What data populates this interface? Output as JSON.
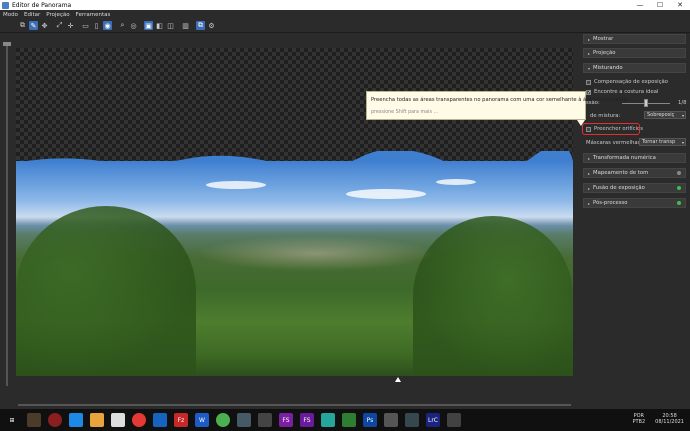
{
  "window": {
    "title": "Editor de Panorama",
    "minimize": "—",
    "maximize": "☐",
    "close": "✕"
  },
  "menu": [
    "Modo",
    "Editar",
    "Projeção",
    "Ferramentas"
  ],
  "sections": {
    "mostrar": "Mostrar",
    "projecao": "Projeção",
    "misturando": "Misturando",
    "transformada": "Transformada numérica",
    "mapeamento": "Mapeamento de tom",
    "fusao": "Fusão de exposição",
    "pos": "Pós-processo"
  },
  "blending": {
    "exposure_comp": "Compensação de exposição",
    "optimal_seam": "Encontre a costura ideal",
    "optimal_seam_checked": true,
    "smoothing_label": "ssão:",
    "smoothing_value": "1/8",
    "blend_mode_label": "de mistura:",
    "blend_mode_value": "Sobreposiç",
    "fill_holes": "Preencher orifícios",
    "red_masks_label": "Máscaras vermelhas:",
    "red_masks_value": "Tornar transp"
  },
  "tooltip": {
    "text": "Preencha todas as áreas transparentes no panorama com uma cor semelhante à área circundante.",
    "hint": "pressione Shift para mais ..."
  },
  "taskbar": {
    "lang": "POR",
    "lang2": "PTB2",
    "time": "20:58",
    "date": "08/11/2021"
  },
  "colors": {
    "accent": "#3d6fb6",
    "highlight": "#e23030",
    "status_green": "#3fbf4a"
  }
}
